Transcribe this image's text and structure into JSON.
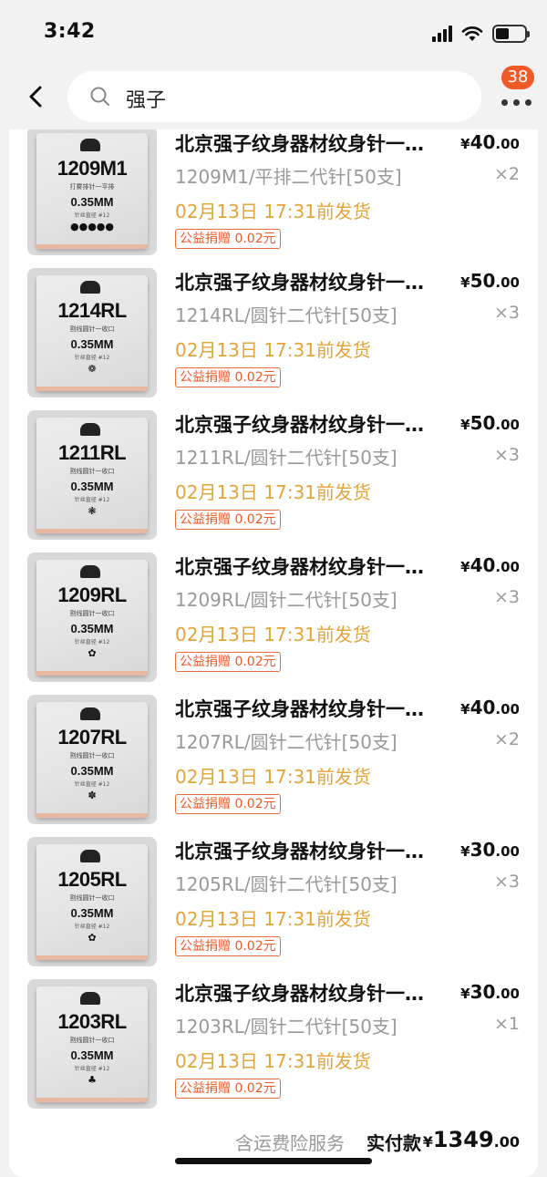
{
  "status_bar": {
    "time": "3:42"
  },
  "search": {
    "query": "强子",
    "badge_count": "38"
  },
  "order": {
    "items": [
      {
        "code": "1209M1",
        "thumb_sub": "打雾排针一平排",
        "size": "0.35MM",
        "thumb_sub2": "针丝直径 #12",
        "thumb_dots": "●●●●●",
        "title": "北京强子纹身器材纹身针一…",
        "currency": "¥",
        "price_int": "40",
        "price_dec": ".00",
        "variant": "1209M1/平排二代针[50支]",
        "qty": "×2",
        "ship": "02月13日 17:31前发货",
        "charity": "公益捐赠 0.02元"
      },
      {
        "code": "1214RL",
        "thumb_sub": "割线圆针一收口",
        "size": "0.35MM",
        "thumb_sub2": "针丝直径 #12",
        "thumb_dots": "❁",
        "title": "北京强子纹身器材纹身针一…",
        "currency": "¥",
        "price_int": "50",
        "price_dec": ".00",
        "variant": "1214RL/圆针二代针[50支]",
        "qty": "×3",
        "ship": "02月13日 17:31前发货",
        "charity": "公益捐赠 0.02元"
      },
      {
        "code": "1211RL",
        "thumb_sub": "割线圆针一收口",
        "size": "0.35MM",
        "thumb_sub2": "针丝直径 #12",
        "thumb_dots": "❃",
        "title": "北京强子纹身器材纹身针一…",
        "currency": "¥",
        "price_int": "50",
        "price_dec": ".00",
        "variant": "1211RL/圆针二代针[50支]",
        "qty": "×3",
        "ship": "02月13日 17:31前发货",
        "charity": "公益捐赠 0.02元"
      },
      {
        "code": "1209RL",
        "thumb_sub": "割线圆针一收口",
        "size": "0.35MM",
        "thumb_sub2": "针丝直径 #12",
        "thumb_dots": "✿",
        "title": "北京强子纹身器材纹身针一…",
        "currency": "¥",
        "price_int": "40",
        "price_dec": ".00",
        "variant": "1209RL/圆针二代针[50支]",
        "qty": "×3",
        "ship": "02月13日 17:31前发货",
        "charity": "公益捐赠 0.02元"
      },
      {
        "code": "1207RL",
        "thumb_sub": "割线圆针一收口",
        "size": "0.35MM",
        "thumb_sub2": "针丝直径 #12",
        "thumb_dots": "✽",
        "title": "北京强子纹身器材纹身针一…",
        "currency": "¥",
        "price_int": "40",
        "price_dec": ".00",
        "variant": "1207RL/圆针二代针[50支]",
        "qty": "×2",
        "ship": "02月13日 17:31前发货",
        "charity": "公益捐赠 0.02元"
      },
      {
        "code": "1205RL",
        "thumb_sub": "割线圆针一收口",
        "size": "0.35MM",
        "thumb_sub2": "针丝直径 #12",
        "thumb_dots": "✿",
        "title": "北京强子纹身器材纹身针一…",
        "currency": "¥",
        "price_int": "30",
        "price_dec": ".00",
        "variant": "1205RL/圆针二代针[50支]",
        "qty": "×3",
        "ship": "02月13日 17:31前发货",
        "charity": "公益捐赠 0.02元"
      },
      {
        "code": "1203RL",
        "thumb_sub": "割线圆针一收口",
        "size": "0.35MM",
        "thumb_sub2": "针丝直径 #12",
        "thumb_dots": "♣",
        "title": "北京强子纹身器材纹身针一…",
        "currency": "¥",
        "price_int": "30",
        "price_dec": ".00",
        "variant": "1203RL/圆针二代针[50支]",
        "qty": "×1",
        "ship": "02月13日 17:31前发货",
        "charity": "公益捐赠 0.02元"
      }
    ],
    "summary": {
      "label": "含运费险服务",
      "paid_label": "实付款",
      "currency": "¥",
      "total_int": "1349",
      "total_dec": ".00"
    }
  },
  "colors": {
    "accent": "#f05a28",
    "ship": "#e3a43a",
    "muted": "#999999"
  }
}
